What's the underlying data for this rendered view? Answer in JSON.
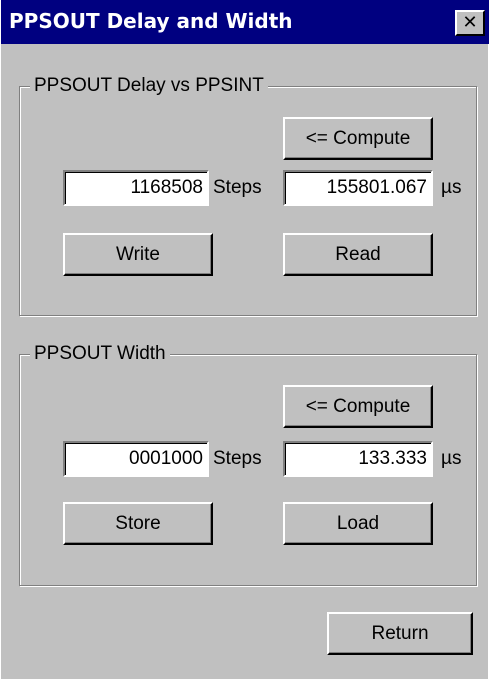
{
  "window": {
    "title": "PPSOUT Delay and Width",
    "close_glyph": "✕"
  },
  "delay_group": {
    "label": "PPSOUT Delay vs PPSINT",
    "compute_label": "<= Compute",
    "steps_value": "1168508",
    "steps_unit": "Steps",
    "time_value": "155801.067",
    "time_unit": "µs",
    "write_label": "Write",
    "read_label": "Read"
  },
  "width_group": {
    "label": "PPSOUT Width",
    "compute_label": "<= Compute",
    "steps_value": "0001000",
    "steps_unit": "Steps",
    "time_value": "133.333",
    "time_unit": "µs",
    "store_label": "Store",
    "load_label": "Load"
  },
  "footer": {
    "return_label": "Return"
  },
  "colors": {
    "titlebar": "#000080",
    "face": "#c0c0c0"
  }
}
